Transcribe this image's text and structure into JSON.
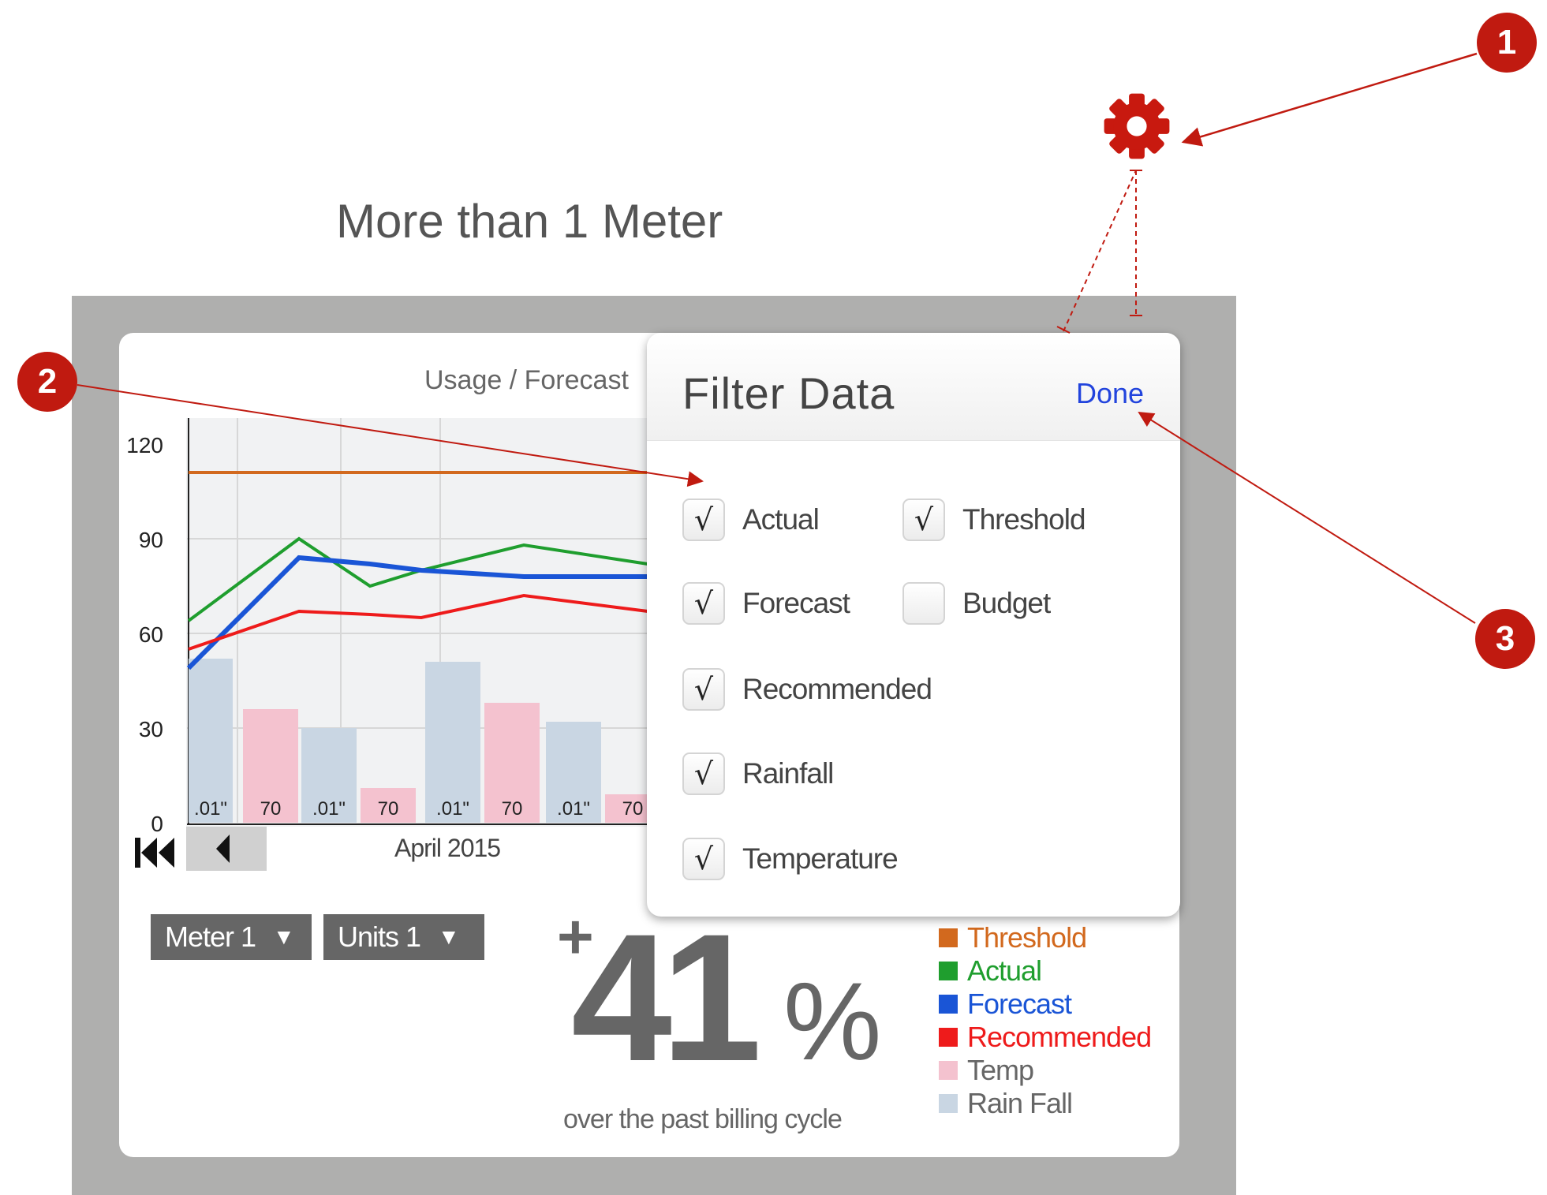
{
  "heading": "More than 1 Meter",
  "annotations": [
    "1",
    "2",
    "3"
  ],
  "chart": {
    "title": "Usage / Forecast",
    "month": "April 2015"
  },
  "chart_data": {
    "type": "bar+line",
    "title": "Usage / Forecast",
    "xlabel": "April 2015",
    "ylim": [
      0,
      120
    ],
    "yticks": [
      "120",
      "90",
      "60",
      "30",
      "0"
    ],
    "threshold": 111,
    "lines": [
      {
        "name": "Actual",
        "color": "#1f9e2e",
        "values": [
          64,
          90,
          75,
          80,
          88,
          82
        ]
      },
      {
        "name": "Forecast",
        "color": "#1a55d6",
        "values": [
          49,
          84,
          82,
          80,
          78,
          78
        ]
      },
      {
        "name": "Recommended",
        "color": "#ee1b1b",
        "values": [
          55,
          67,
          66,
          65,
          72,
          67
        ]
      }
    ],
    "bars": [
      {
        "series": "Rain Fall",
        "value": 52,
        "label": ".01\""
      },
      {
        "series": "Temp",
        "value": 36,
        "label": "70"
      },
      {
        "series": "Rain Fall",
        "value": 30,
        "label": ".01\""
      },
      {
        "series": "Temp",
        "value": 11,
        "label": "70"
      },
      {
        "series": "Rain Fall",
        "value": 51,
        "label": ".01\""
      },
      {
        "series": "Temp",
        "value": 38,
        "label": "70"
      },
      {
        "series": "Rain Fall",
        "value": 32,
        "label": ".01\""
      },
      {
        "series": "Temp",
        "value": 9,
        "label": "70"
      }
    ]
  },
  "selectors": {
    "meter": "Meter 1",
    "units": "Units 1"
  },
  "stat": {
    "prefix": "+",
    "value": "41",
    "suffix": "%",
    "caption": "over the past billing cycle"
  },
  "legend": [
    {
      "label": "Threshold",
      "color": "#d2691e"
    },
    {
      "label": "Actual",
      "color": "#1f9e2e"
    },
    {
      "label": "Forecast",
      "color": "#1a55d6"
    },
    {
      "label": "Recommended",
      "color": "#ee1b1b"
    },
    {
      "label": "Temp",
      "color": "#f4c2cf"
    },
    {
      "label": "Rain Fall",
      "color": "#c9d6e3"
    }
  ],
  "filter": {
    "title": "Filter Data",
    "done": "Done",
    "options": [
      {
        "label": "Actual",
        "checked": true
      },
      {
        "label": "Threshold",
        "checked": true
      },
      {
        "label": "Forecast",
        "checked": true
      },
      {
        "label": "Budget",
        "checked": false
      },
      {
        "label": "Recommended",
        "checked": true
      },
      {
        "label": "Rainfall",
        "checked": true
      },
      {
        "label": "Temperature",
        "checked": true
      }
    ],
    "check_glyph": "√"
  }
}
